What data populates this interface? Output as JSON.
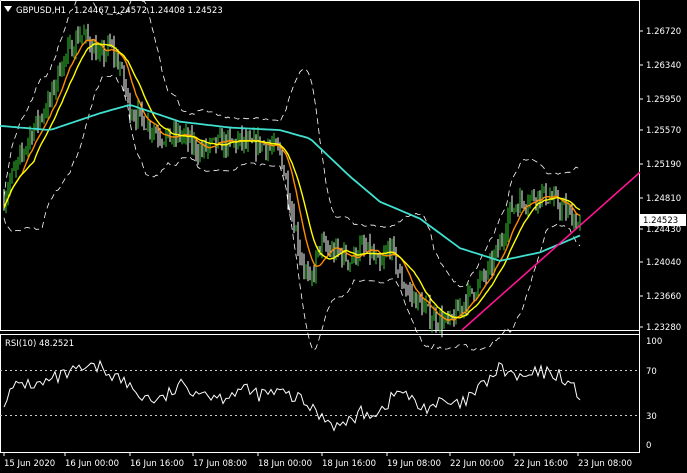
{
  "header": {
    "triangle_icon": "triangle-down-icon",
    "symbol": "GBPUSD,H1",
    "ohlc": "1.24467 1.24572 1.24408 1.24523"
  },
  "rsi": {
    "label": "RSI(10) 48.2521",
    "levels": [
      "100",
      "70",
      "30",
      "0"
    ]
  },
  "price_axis": {
    "ticks": [
      "1.26720",
      "1.26340",
      "1.25950",
      "1.25570",
      "1.25190",
      "1.24810",
      "1.24430",
      "1.24040",
      "1.23660",
      "1.23280"
    ],
    "current_price": "1.24523",
    "current_price_bg": "#ffffff"
  },
  "time_axis": {
    "ticks": [
      "15 Jun 2020",
      "16 Jun 00:00",
      "16 Jun 16:00",
      "17 Jun 08:00",
      "18 Jun 00:00",
      "18 Jun 16:00",
      "19 Jun 08:00",
      "22 Jun 00:00",
      "22 Jun 16:00",
      "23 Jun 08:00"
    ]
  },
  "colors": {
    "background": "#000000",
    "bull_candle": "#32cd32",
    "bear_candle": "#ffffff",
    "ma_fast": "#ff8c00",
    "ma_medium": "#ffff00",
    "ma_slow": "#40e0d0",
    "bollinger": "#ffffff",
    "trendline": "#ff1493",
    "rsi_line": "#ffffff"
  },
  "chart_data": [
    {
      "type": "candlestick",
      "series": [
        {
          "name": "close",
          "x": [
            0,
            10,
            20,
            30,
            40,
            50,
            60,
            70,
            80,
            90,
            100,
            110,
            120,
            130,
            140,
            150,
            160,
            170,
            180,
            190,
            200,
            210,
            220,
            230,
            240,
            250,
            260,
            270,
            280,
            290,
            300,
            310,
            320,
            330,
            340,
            350,
            360,
            370,
            380,
            390,
            400,
            410,
            420,
            430,
            440,
            450,
            460,
            470,
            480,
            490,
            500,
            510,
            520,
            530,
            540,
            550,
            560,
            570,
            580
          ],
          "values": [
            1.247,
            1.2505,
            1.253,
            1.256,
            1.258,
            1.26,
            1.264,
            1.266,
            1.268,
            1.267,
            1.265,
            1.2665,
            1.264,
            1.259,
            1.258,
            1.257,
            1.256,
            1.2555,
            1.256,
            1.255,
            1.254,
            1.2545,
            1.255,
            1.2548,
            1.2552,
            1.2545,
            1.255,
            1.2545,
            1.254,
            1.248,
            1.242,
            1.238,
            1.243,
            1.242,
            1.242,
            1.241,
            1.2425,
            1.242,
            1.24,
            1.243,
            1.239,
            1.237,
            1.236,
            1.2345,
            1.234,
            1.2335,
            1.2355,
            1.237,
            1.2385,
            1.24,
            1.243,
            1.247,
            1.248,
            1.2485,
            1.249,
            1.2485,
            1.2475,
            1.2465,
            1.2452
          ]
        },
        {
          "name": "ma_slow",
          "x": [
            0,
            50,
            100,
            130,
            180,
            230,
            280,
            310,
            350,
            380,
            420,
            460,
            500,
            540,
            580
          ],
          "values": [
            1.257,
            1.2565,
            1.2585,
            1.2595,
            1.2575,
            1.2568,
            1.2565,
            1.2555,
            1.251,
            1.248,
            1.246,
            1.2425,
            1.241,
            1.242,
            1.244
          ]
        },
        {
          "name": "trendline",
          "x": [
            462,
            640
          ],
          "values": [
            1.2328,
            1.2515
          ]
        }
      ],
      "ylim": [
        1.2328,
        1.2705
      ]
    },
    {
      "type": "line",
      "series": [
        {
          "name": "RSI(10)",
          "x": [
            0,
            20,
            40,
            60,
            80,
            100,
            120,
            140,
            160,
            180,
            200,
            220,
            240,
            260,
            280,
            300,
            320,
            340,
            360,
            380,
            400,
            420,
            440,
            460,
            480,
            500,
            520,
            540,
            560,
            580
          ],
          "values": [
            40,
            60,
            58,
            66,
            72,
            75,
            64,
            48,
            43,
            57,
            53,
            46,
            54,
            49,
            51,
            44,
            30,
            18,
            31,
            33,
            54,
            36,
            41,
            38,
            55,
            74,
            64,
            70,
            68,
            48
          ]
        }
      ],
      "ylim": [
        0,
        100
      ]
    }
  ]
}
